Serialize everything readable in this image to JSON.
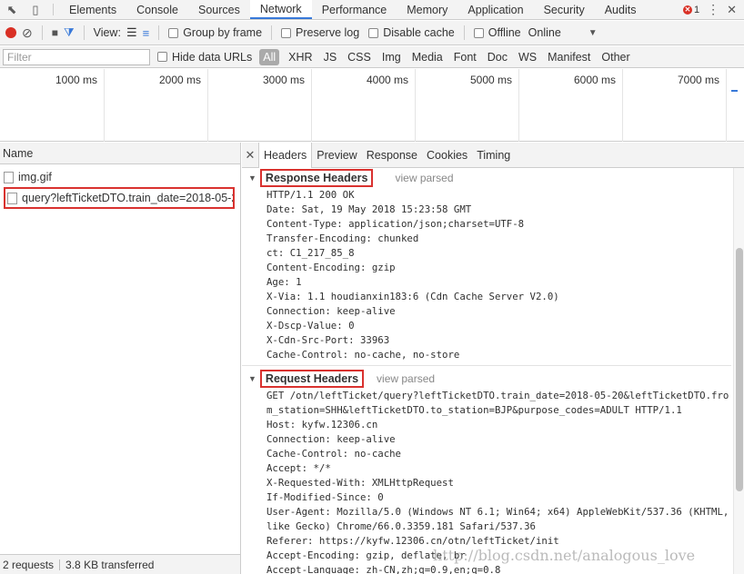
{
  "tabs": [
    "Elements",
    "Console",
    "Sources",
    "Network",
    "Performance",
    "Memory",
    "Application",
    "Security",
    "Audits"
  ],
  "active_tab": "Network",
  "error_count": "1",
  "toolbar": {
    "view_label": "View:",
    "group_by_frame": "Group by frame",
    "preserve_log": "Preserve log",
    "disable_cache": "Disable cache",
    "offline": "Offline",
    "throttle_value": "Online"
  },
  "filter": {
    "placeholder": "Filter",
    "hide_data_urls": "Hide data URLs",
    "types": [
      "All",
      "XHR",
      "JS",
      "CSS",
      "Img",
      "Media",
      "Font",
      "Doc",
      "WS",
      "Manifest",
      "Other"
    ]
  },
  "timeline_ticks": [
    "1000 ms",
    "2000 ms",
    "3000 ms",
    "4000 ms",
    "5000 ms",
    "6000 ms",
    "7000 ms"
  ],
  "request_list": {
    "header": "Name",
    "items": [
      "img.gif",
      "query?leftTicketDTO.train_date=2018-05-2..."
    ],
    "status_requests": "2 requests",
    "status_transferred": "3.8 KB transferred"
  },
  "detail_tabs": [
    "Headers",
    "Preview",
    "Response",
    "Cookies",
    "Timing"
  ],
  "response_headers": {
    "title": "Response Headers",
    "view_parsed": "view parsed",
    "lines": [
      "HTTP/1.1 200 OK",
      "Date: Sat, 19 May 2018 15:23:58 GMT",
      "Content-Type: application/json;charset=UTF-8",
      "Transfer-Encoding: chunked",
      "ct: C1_217_85_8",
      "Content-Encoding: gzip",
      "Age: 1",
      "X-Via: 1.1 houdianxin183:6 (Cdn Cache Server V2.0)",
      "Connection: keep-alive",
      "X-Dscp-Value: 0",
      "X-Cdn-Src-Port: 33963",
      "Cache-Control: no-cache, no-store"
    ]
  },
  "request_headers": {
    "title": "Request Headers",
    "view_parsed": "view parsed",
    "request_line": "GET /otn/leftTicket/query?leftTicketDTO.train_date=2018-05-20&leftTicketDTO.from_station=SHH&leftTicketDTO.to_station=BJP&purpose_codes=ADULT HTTP/1.1",
    "lines": [
      "Host: kyfw.12306.cn",
      "Connection: keep-alive",
      "Cache-Control: no-cache",
      "Accept: */*",
      "X-Requested-With: XMLHttpRequest",
      "If-Modified-Since: 0"
    ],
    "user_agent": "User-Agent: Mozilla/5.0 (Windows NT 6.1; Win64; x64) AppleWebKit/537.36 (KHTML, like Gecko) Chrome/66.0.3359.181 Safari/537.36",
    "lines_after": [
      "Referer: https://kyfw.12306.cn/otn/leftTicket/init",
      "Accept-Encoding: gzip, deflate, br",
      "Accept-Language: zh-CN,zh;q=0.9,en;q=0.8"
    ]
  },
  "watermark": "http://blog.csdn.net/analogous_love",
  "colors": {
    "accent": "#3879d9",
    "highlight_box": "#d9322f",
    "record": "#d93025"
  }
}
